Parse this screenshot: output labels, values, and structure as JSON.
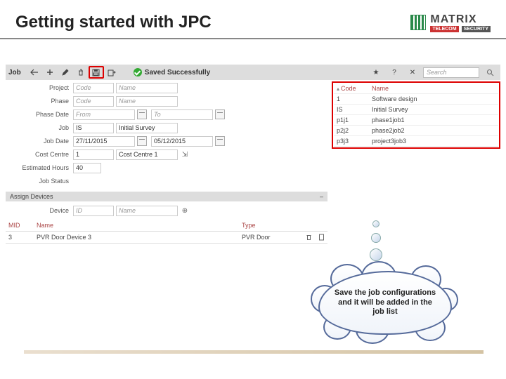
{
  "header": {
    "title": "Getting started with JPC",
    "logo_main": "MATRIX",
    "logo_sub_left": "TELECOM",
    "logo_sub_right": "SECURITY"
  },
  "toolbar": {
    "section_label": "Job",
    "saved_message": "Saved Successfully",
    "search_placeholder": "Search"
  },
  "form": {
    "project": {
      "label": "Project",
      "code_ph": "Code",
      "name_ph": "Name"
    },
    "phase": {
      "label": "Phase",
      "code_ph": "Code",
      "name_ph": "Name"
    },
    "phase_date": {
      "label": "Phase Date",
      "from_ph": "From",
      "to_ph": "To"
    },
    "job": {
      "label": "Job",
      "code": "IS",
      "name": "Initial Survey"
    },
    "job_date": {
      "label": "Job Date",
      "from": "27/11/2015",
      "to": "05/12/2015"
    },
    "cost_centre": {
      "label": "Cost Centre",
      "code": "1",
      "name": "Cost Centre 1"
    },
    "est_hours": {
      "label": "Estimated Hours",
      "value": "40"
    },
    "job_status": {
      "label": "Job Status"
    }
  },
  "assign_devices": {
    "title": "Assign Devices",
    "device_label": "Device",
    "id_ph": "ID",
    "name_ph": "Name",
    "columns": {
      "mid": "MID",
      "name": "Name",
      "type": "Type"
    },
    "rows": [
      {
        "mid": "3",
        "name": "PVR Door Device 3",
        "type": "PVR Door"
      }
    ]
  },
  "job_list": {
    "columns": {
      "code": "Code",
      "name": "Name"
    },
    "rows": [
      {
        "code": "1",
        "name": "Software design"
      },
      {
        "code": "IS",
        "name": "Initial Survey"
      },
      {
        "code": "p1j1",
        "name": "phase1job1"
      },
      {
        "code": "p2j2",
        "name": "phase2job2"
      },
      {
        "code": "p3j3",
        "name": "project3job3"
      }
    ]
  },
  "callout": {
    "text": "Save the job configurations and it will be added in the job list"
  }
}
